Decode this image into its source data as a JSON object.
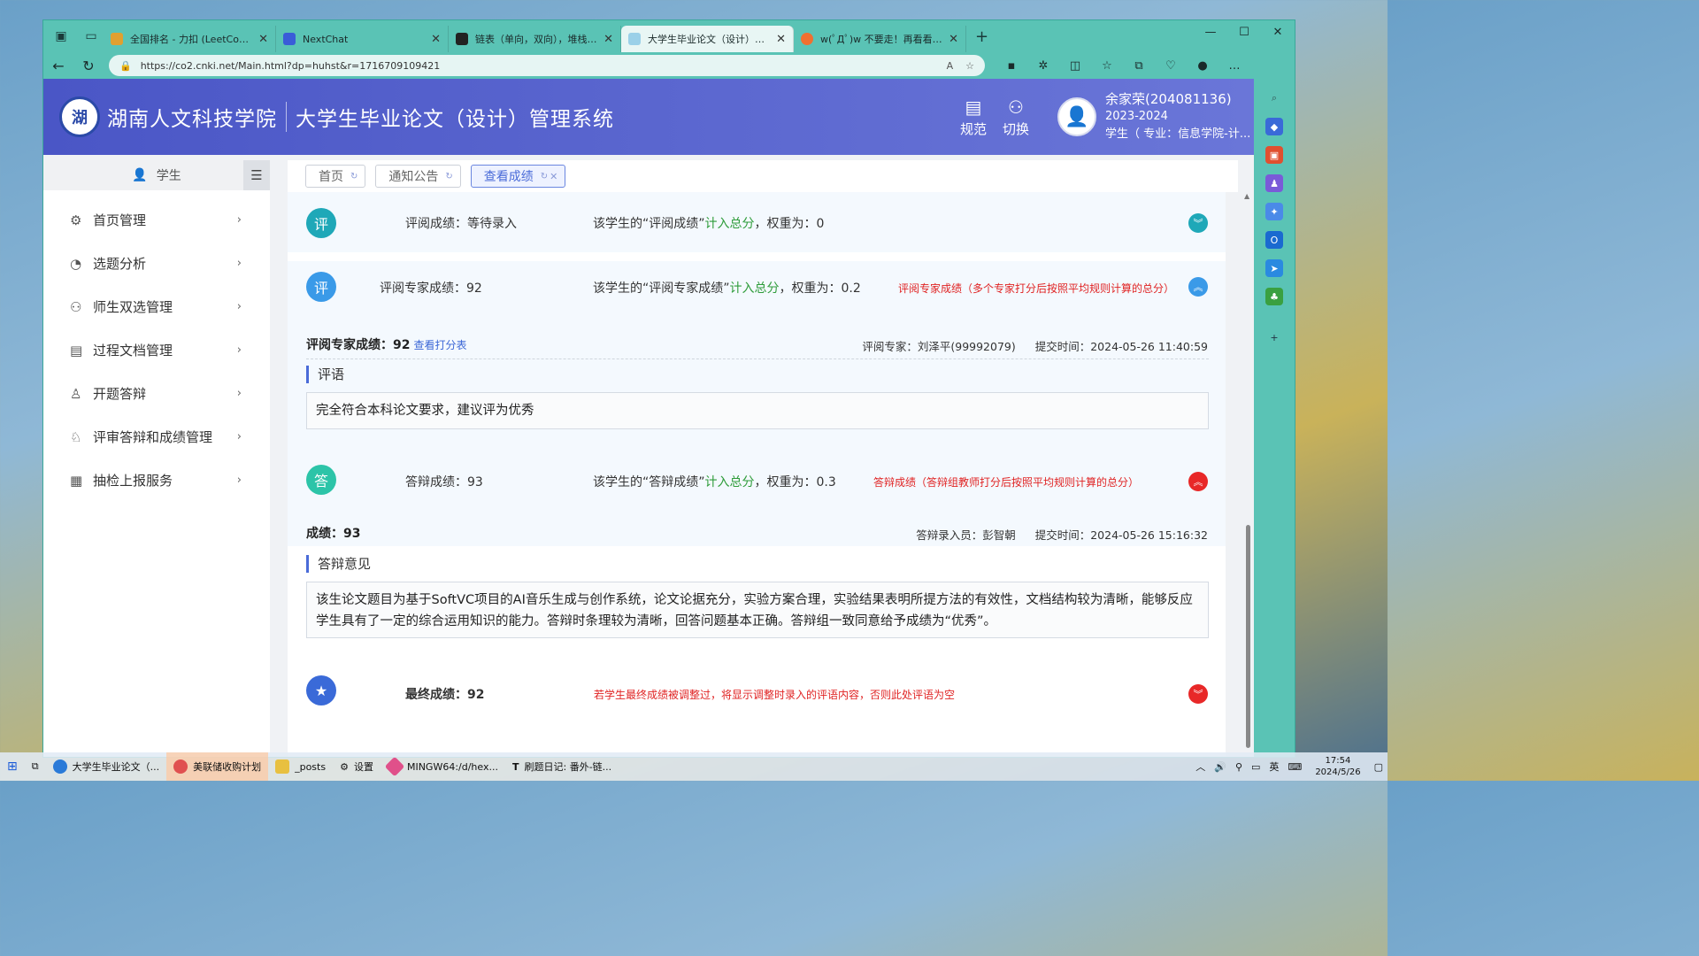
{
  "browser": {
    "tabs": [
      {
        "title": "全国排名 - 力扣 (LeetCode)",
        "color": "#e0a030"
      },
      {
        "title": "NextChat",
        "color": "#3a5cd8"
      },
      {
        "title": "链表（单向，双向），堆栈，队列",
        "color": "#222222"
      },
      {
        "title": "大学生毕业论文（设计）管理系统",
        "color": "#9ad0e8",
        "active": true
      },
      {
        "title": "w(ﾟДﾟ)w 不要走！再看看嘛！",
        "color": "#f07030"
      }
    ],
    "url": "https://co2.cnki.net/Main.html?dp=huhst&r=1716709109421"
  },
  "header": {
    "school": "湖南人文科技学院",
    "system": "大学生毕业论文（设计）管理系统",
    "actions": [
      {
        "label": "规范",
        "icon": "doc-icon"
      },
      {
        "label": "切换",
        "icon": "switch-user-icon"
      }
    ],
    "user": {
      "name": "余家荣(204081136)",
      "year": "2023-2024",
      "role": "学生（ 专业：信息学院-计..."
    }
  },
  "sidebar": {
    "title": "学生",
    "items": [
      {
        "label": "首页管理",
        "icon": "gear-icon"
      },
      {
        "label": "选题分析",
        "icon": "clock-icon"
      },
      {
        "label": "师生双选管理",
        "icon": "people-icon"
      },
      {
        "label": "过程文档管理",
        "icon": "document-icon"
      },
      {
        "label": "开题答辩",
        "icon": "user-icon"
      },
      {
        "label": "评审答辩和成绩管理",
        "icon": "review-icon"
      },
      {
        "label": "抽检上报服务",
        "icon": "report-icon"
      }
    ]
  },
  "pageTabs": [
    {
      "label": "首页"
    },
    {
      "label": "通知公告"
    },
    {
      "label": "查看成绩",
      "active": true
    }
  ],
  "grades": {
    "review": {
      "badge": "评",
      "label": "评阅成绩：等待录入",
      "desc_pre": "该学生的“评阅成绩”",
      "desc_green": "计入总分",
      "desc_post": "，权重为：0"
    },
    "expert": {
      "badge": "评",
      "label": "评阅专家成绩：92",
      "desc_pre": "该学生的“评阅专家成绩”",
      "desc_green": "计入总分",
      "desc_post": "，权重为：0.2",
      "note": "评阅专家成绩（多个专家打分后按照平均规则计算的总分）",
      "detail_label": "评阅专家成绩：",
      "detail_score": "92",
      "detail_link": "查看打分表",
      "expert_name": "评阅专家：刘泽平(99992079)",
      "submit_time": "提交时间：2024-05-26 11:40:59",
      "comment_title": "评语",
      "comment": "完全符合本科论文要求，建议评为优秀"
    },
    "defense": {
      "badge": "答",
      "label": "答辩成绩：93",
      "desc_pre": "该学生的“答辩成绩”",
      "desc_green": "计入总分",
      "desc_post": "，权重为：0.3",
      "note": "答辩成绩（答辩组教师打分后按照平均规则计算的总分）",
      "detail_label": "成绩：",
      "detail_score": "93",
      "recorder": "答辩录入员：彭智朝",
      "submit_time": "提交时间：2024-05-26 15:16:32",
      "opinion_title": "答辩意见",
      "opinion": "该生论文题目为基于SoftVC项目的AI音乐生成与创作系统，论文论据充分，实验方案合理，实验结果表明所提方法的有效性，文档结构较为清晰，能够反应学生具有了一定的综合运用知识的能力。答辩时条理较为清晰，回答问题基本正确。答辩组一致同意给予成绩为“优秀”。"
    },
    "final": {
      "label": "最终成绩：",
      "score": "92",
      "note": "若学生最终成绩被调整过，将显示调整时录入的评语内容，否则此处评语为空"
    }
  },
  "taskbar": {
    "items": [
      {
        "label": "大学生毕业论文（...",
        "color": "#2a7ad8"
      },
      {
        "label": "美联储收购计划",
        "color": "#e05050",
        "active": true
      },
      {
        "label": "_posts",
        "color": "#e8c040"
      },
      {
        "label": "设置",
        "color": "#555555"
      },
      {
        "label": "MINGW64:/d/hex...",
        "color": "#e0508a"
      },
      {
        "label": "刷题日记: 番外-链...",
        "color": "#444444"
      }
    ],
    "ime": "英",
    "time": "17:54",
    "date": "2024/5/26"
  },
  "colors": {
    "header": "#4a56c6",
    "green": "#2e9c3a",
    "red": "#e02424",
    "teal": "#5ac3b5"
  }
}
